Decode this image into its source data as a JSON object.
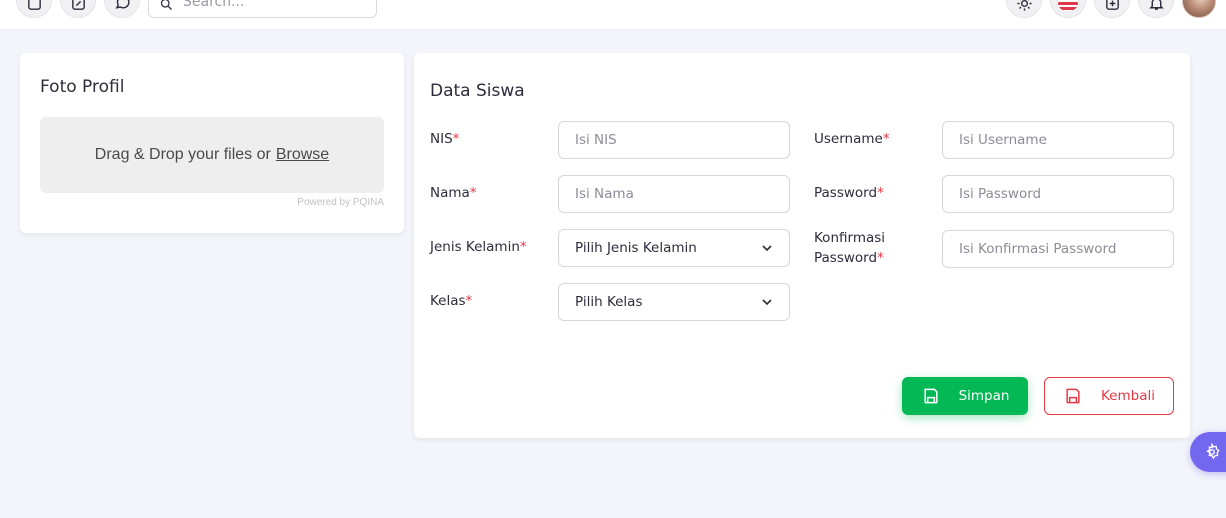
{
  "header": {
    "search_placeholder": "Search...",
    "icons": [
      "app-icon",
      "edit-icon",
      "chat-icon",
      "search-icon",
      "sun-icon",
      "us-flag-icon",
      "apps-icon",
      "bell-icon",
      "avatar"
    ]
  },
  "foto_profil": {
    "title": "Foto Profil",
    "drop_text": "Drag & Drop your files or",
    "browse_label": "Browse",
    "powered_by": "Powered by PQINA"
  },
  "data_siswa": {
    "title": "Data Siswa",
    "required_mark": "*",
    "nis": {
      "label": "NIS",
      "placeholder": "Isi NIS",
      "value": ""
    },
    "nama": {
      "label": "Nama",
      "placeholder": "Isi Nama",
      "value": ""
    },
    "jenis_kelamin": {
      "label": "Jenis Kelamin",
      "selected": "Pilih Jenis Kelamin"
    },
    "kelas": {
      "label": "Kelas",
      "selected": "Pilih Kelas"
    },
    "username": {
      "label": "Username",
      "placeholder": "Isi Username",
      "value": ""
    },
    "password": {
      "label": "Password",
      "placeholder": "Isi Password",
      "value": ""
    },
    "konfirmasi_password": {
      "label_line1": "Konfirmasi",
      "label_line2": "Password",
      "placeholder": "Isi Konfirmasi Password",
      "value": ""
    }
  },
  "actions": {
    "save_label": "Simpan",
    "back_label": "Kembali"
  },
  "colors": {
    "primary": "#7367f0",
    "success": "#04b955",
    "danger": "#e53945",
    "background": "#f4f5fa"
  }
}
